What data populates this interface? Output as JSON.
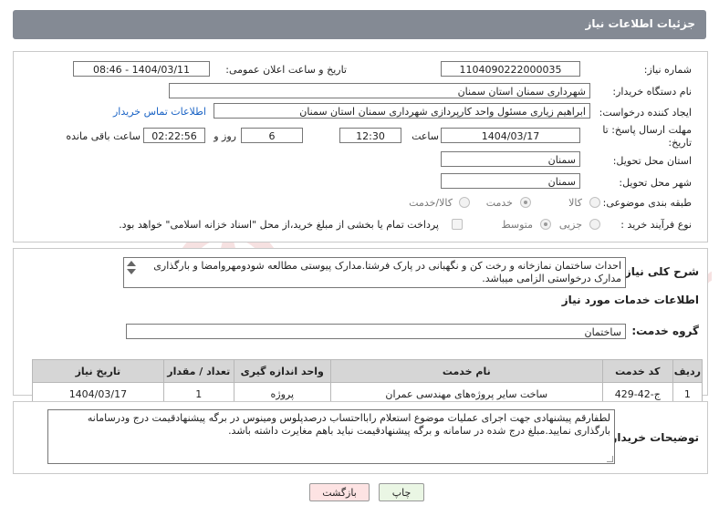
{
  "header": {
    "title": "جزئیات اطلاعات نیاز"
  },
  "fields": {
    "need_number_label": "شماره نیاز:",
    "need_number": "1104090222000035",
    "announce_label": "تاریخ و ساعت اعلان عمومی:",
    "announce_value": "1404/03/11 - 08:46",
    "buyer_org_label": "نام دستگاه خریدار:",
    "buyer_org": "شهرداری سمنان استان سمنان",
    "requester_label": "ایجاد کننده درخواست:",
    "requester": "ابراهیم زیاری مسئول واحد کارپردازی شهرداری سمنان استان سمنان",
    "contact_link": "اطلاعات تماس خریدار",
    "deadline_label_1": "مهلت ارسال پاسخ: تا",
    "deadline_label_2": "تاریخ:",
    "deadline_date": "1404/03/17",
    "time_label": "ساعت",
    "deadline_time": "12:30",
    "days_value": "6",
    "days_label": "روز و",
    "remaining_time": "02:22:56",
    "remaining_label": "ساعت باقی مانده",
    "province_label": "استان محل تحویل:",
    "province": "سمنان",
    "city_label": "شهر محل تحویل:",
    "city": "سمنان",
    "category_label": "طبقه بندی موضوعی:",
    "category_options": [
      "کالا",
      "خدمت",
      "کالا/خدمت"
    ],
    "category_selected": "خدمت",
    "process_label": "نوع فرآیند خرید :",
    "process_options": [
      "جزیی",
      "متوسط"
    ],
    "process_selected": "متوسط",
    "payment_note": "پرداخت تمام یا بخشی از مبلغ خرید،از محل \"اسناد خزانه اسلامی\" خواهد بود."
  },
  "description": {
    "label": "شرح کلی نیاز:",
    "text": "احداث ساختمان نمازخانه و رخت کن و نگهبانی در پارک فرشتا.مدارک پیوستی مطالعه شودومهروامضا و بارگذاری مدارک درخواستی الزامی میباشد."
  },
  "services": {
    "section_title": "اطلاعات خدمات مورد نیاز",
    "group_label": "گروه خدمت:",
    "group_value": "ساختمان",
    "columns": [
      "ردیف",
      "کد خدمت",
      "نام خدمت",
      "واحد اندازه گیری",
      "تعداد / مقدار",
      "تاریخ نیاز"
    ],
    "rows": [
      [
        "1",
        "ج-42-429",
        "ساخت سایر پروژه‌های مهندسی عمران",
        "پروژه",
        "1",
        "1404/03/17"
      ]
    ]
  },
  "buyer_notes": {
    "label": "توضیحات خریدار:",
    "text": "لطفارقم پیشنهادی جهت اجرای عملیات موضوع استعلام رابااحتساب درصدپلوس ومینوس در برگه پیشنهادقیمت درج ودرسامانه بارگذاری نمایید.مبلغ درج شده در سامانه و برگه پیشنهادقیمت نباید باهم مغایرت داشته باشد."
  },
  "buttons": {
    "print": "چاپ",
    "back": "بازگشت"
  },
  "colors": {
    "header_bg": "#848a94",
    "link": "#1a63c5",
    "back_btn_bg": "#fde3e3",
    "print_btn_bg": "#eaf6e4"
  }
}
